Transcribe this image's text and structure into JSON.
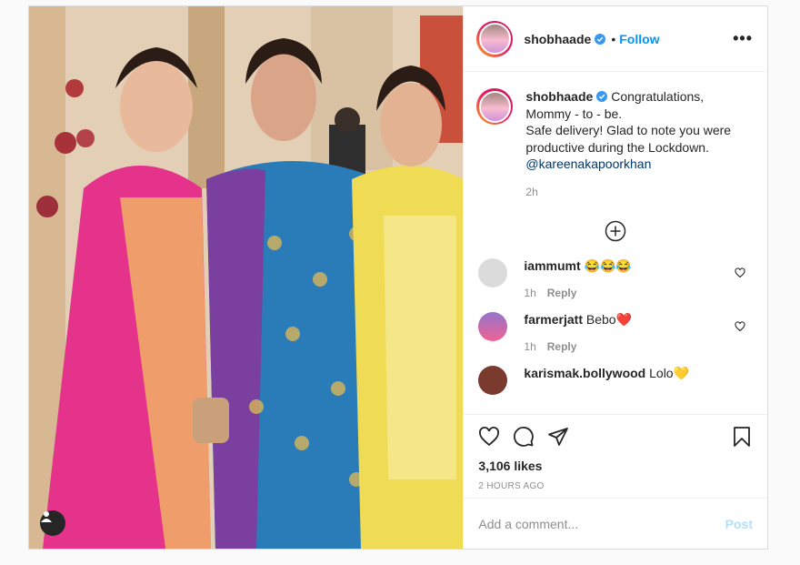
{
  "post": {
    "username": "shobhaade",
    "follow_label": "Follow",
    "more_label": "•••",
    "caption_username": "shobhaade",
    "caption_lines": [
      "Congratulations,",
      "Mommy - to - be.",
      "Safe delivery! Glad to note you were",
      "productive during the Lockdown."
    ],
    "caption_mention": "@kareenakapoorkhan",
    "caption_time": "2h",
    "comments": [
      {
        "username": "iammumt",
        "text": "😂😂😂",
        "time": "1h",
        "reply": "Reply"
      },
      {
        "username": "farmerjatt",
        "text": "Bebo❤️",
        "time": "1h",
        "reply": "Reply"
      },
      {
        "username": "karismak.bollywood",
        "text": "Lolo💛",
        "time": "",
        "reply": ""
      }
    ],
    "likes": "3,106 likes",
    "posted_ago": "2 HOURS AGO",
    "add_comment_placeholder": "Add a comment...",
    "post_label": "Post"
  },
  "colors": {
    "accent": "#0095f6",
    "post_disabled": "#b2dffc"
  }
}
